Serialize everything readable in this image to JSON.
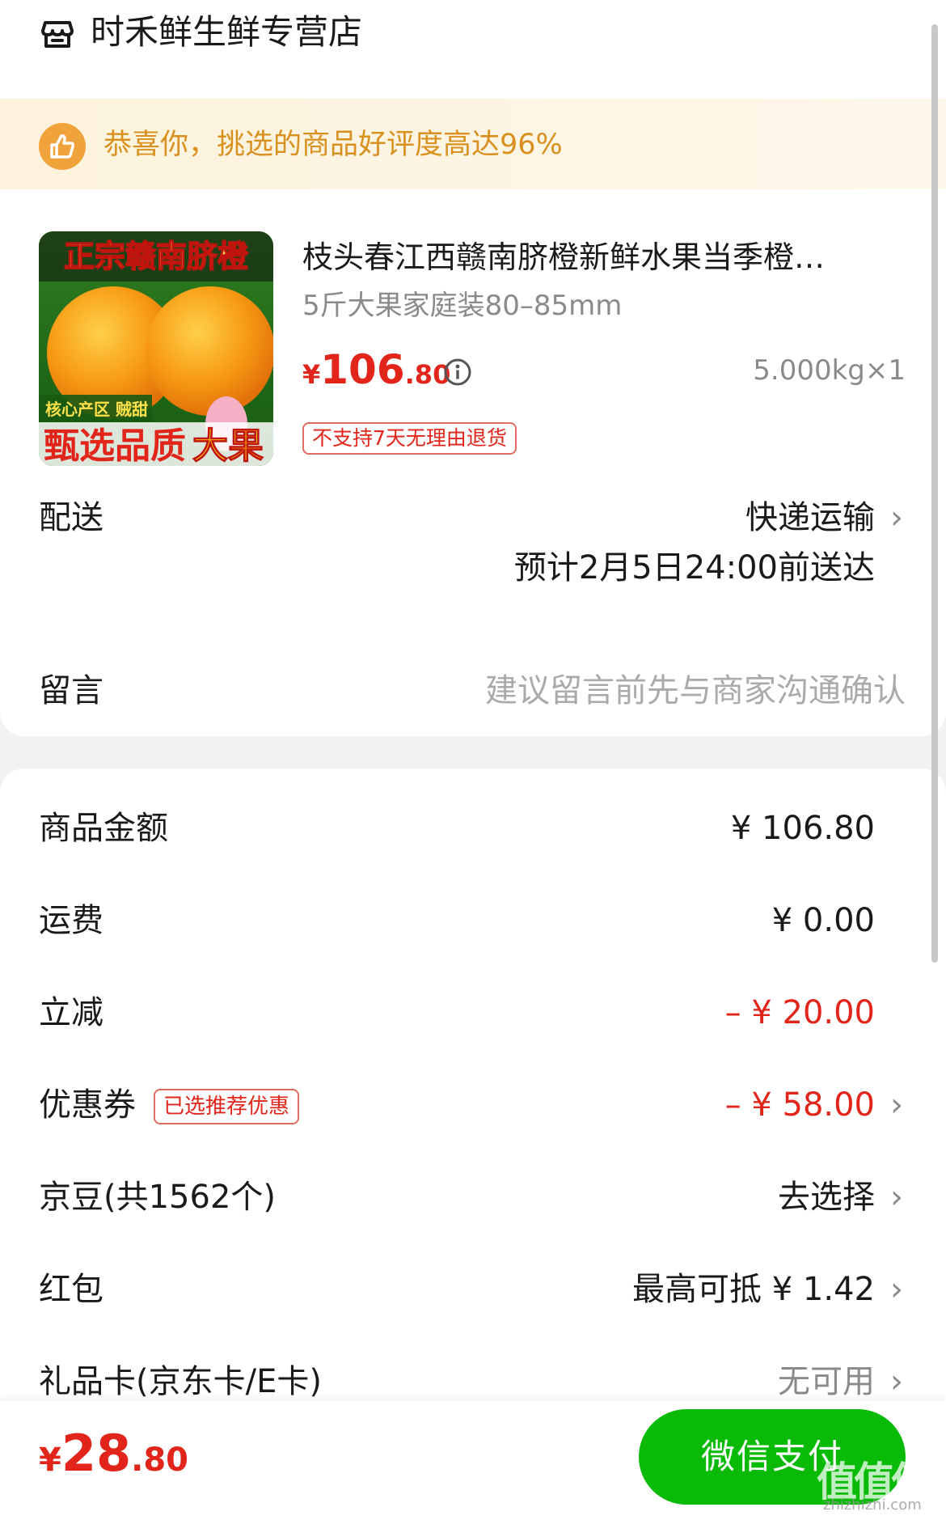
{
  "store": {
    "name": "时禾鲜生鲜专营店",
    "icon": "store-icon"
  },
  "banner": {
    "text": "恭喜你，挑选的商品好评度高达96%",
    "icon": "thumbs-up-icon"
  },
  "product": {
    "title": "枝头春江西赣南脐橙新鲜水果当季橙…",
    "spec": "5斤大果家庭装80–85mm",
    "price_symbol": "¥",
    "price_int": "106",
    "price_dec": ".80",
    "quantity": "5.000kg×1",
    "return_tag": "不支持7天无理由退货",
    "image_text_top": "正宗赣南脐橙",
    "image_text_mid": "核心产区 贼甜",
    "image_text_bottom_1": "甄选品质",
    "image_text_bottom_2": "大果"
  },
  "delivery": {
    "label": "配送",
    "method": "快递运输",
    "eta": "预计2月5日24:00前送达"
  },
  "message": {
    "label": "留言",
    "placeholder": "建议留言前先与商家沟通确认"
  },
  "costs": [
    {
      "label": "商品金额",
      "value": "¥ 106.80"
    },
    {
      "label": "运费",
      "value": "¥ 0.00"
    },
    {
      "label": "立减",
      "value": "– ¥ 20.00"
    },
    {
      "label": "优惠券",
      "tag": "已选推荐优惠",
      "value": "– ¥ 58.00"
    },
    {
      "label": "京豆(共1562个)",
      "value": "去选择"
    },
    {
      "label": "红包",
      "value": "最高可抵 ¥ 1.42"
    },
    {
      "label": "礼品卡(京东卡/E卡)",
      "value": "无可用"
    }
  ],
  "footer": {
    "total_symbol": "¥",
    "total_int": "28",
    "total_dec": ".80",
    "pay_label": "微信支付",
    "watermark": "值值值",
    "watermark_url": "zhizhizhi.com"
  },
  "colors": {
    "accent": "#e1251b",
    "pay_green": "#09bb07",
    "banner_text": "#d9901f"
  }
}
